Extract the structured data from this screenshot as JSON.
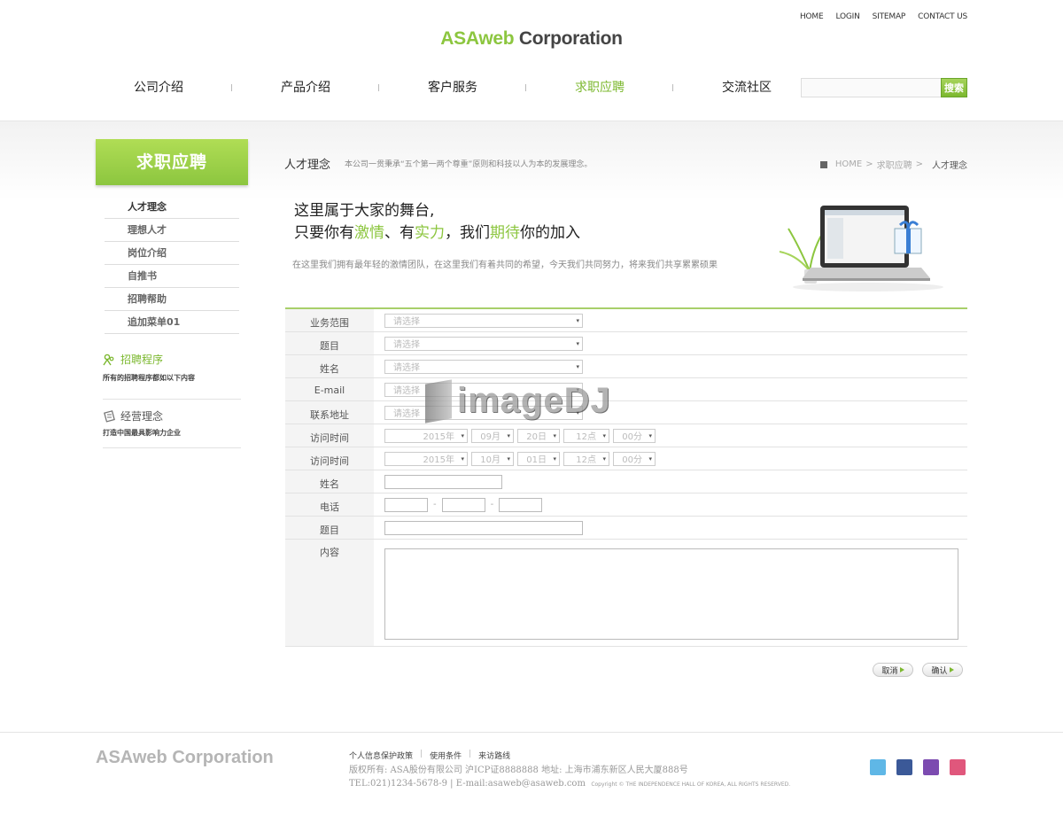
{
  "header": {
    "util_links": [
      "HOME",
      "LOGIN",
      "SITEMAP",
      "CONTACT US"
    ],
    "logo_brand": "ASAweb",
    "logo_rest": " Corporation",
    "nav": [
      "公司介绍",
      "产品介绍",
      "客户服务",
      "求职应聘",
      "交流社区"
    ],
    "search_button": "搜索",
    "search_value": ""
  },
  "sidebar": {
    "title": "求职应聘",
    "menu": [
      "人才理念",
      "理想人才",
      "岗位介绍",
      "自推书",
      "招聘帮助",
      "追加菜单01"
    ],
    "box1_title": "招聘程序",
    "box1_desc": "所有的招聘程序都如以下内容",
    "box2_title": "经营理念",
    "box2_desc": "打造中国最具影响力企业"
  },
  "page": {
    "title": "人才理念",
    "desc": "本公司一贯秉承“五个第一两个尊重”原则和科技以人为本的发展理念。",
    "breadcrumb": [
      "HOME",
      "求职应聘",
      "人才理念"
    ],
    "hero_line1": "这里属于大家的舞台,",
    "hero_line2": [
      "只要你有",
      "激情",
      "、有",
      "实力",
      "，我们",
      "期待",
      "你的加入"
    ],
    "hero_sub": "在这里我们拥有最年轻的激情团队，在这里我们有着共同的希望，今天我们共同努力，将来我们共享累累硕果"
  },
  "form": {
    "labels": [
      "业务范围",
      "题目",
      "姓名",
      "E-mail",
      "联系地址",
      "访问时间",
      "访问时间",
      "姓名",
      "电话",
      "题目",
      "内容"
    ],
    "select_placeholder": "请选择",
    "date1": [
      "2015年",
      "09月",
      "20日",
      "12点",
      "00分"
    ],
    "date2": [
      "2015年",
      "10月",
      "01日",
      "12点",
      "00分"
    ],
    "phone_sep": "-",
    "cancel": "取消",
    "confirm": "确认"
  },
  "watermark": "imageDJ",
  "footer": {
    "logo": "ASAweb Corporation",
    "links": [
      "个人信息保护政策",
      "使用条件",
      "来访路线"
    ],
    "copyright": "版权所有: ASA股份有限公司 沪ICP证8888888 地址: 上海市浦东新区人民大厦888号",
    "contact": "TEL:021)1234-5678-9 | E-mail:asaweb@asaweb.com",
    "small": "Copyright © THE INDEPENDENCE HALL OF KOREA, ALL RIGHTS RESERVED.",
    "social": [
      "twitter-icon",
      "facebook-icon",
      "blog-icon",
      "instagram-icon"
    ]
  },
  "colors": {
    "accent": "#8cc63f",
    "accent_dark": "#7cb82f"
  }
}
